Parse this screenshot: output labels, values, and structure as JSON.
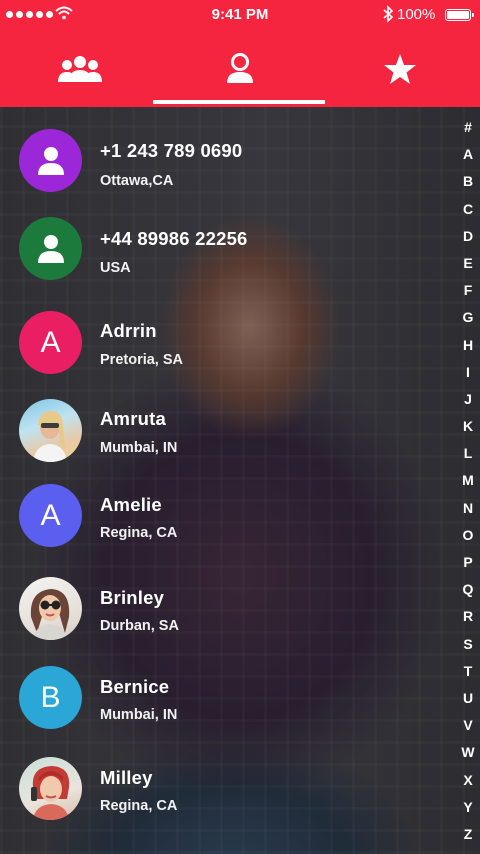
{
  "status_bar": {
    "time": "9:41 PM",
    "battery": "100%"
  },
  "tabs": [
    {
      "name": "groups",
      "icon": "group-icon",
      "selected": false
    },
    {
      "name": "contacts",
      "icon": "person-icon",
      "selected": true
    },
    {
      "name": "favorites",
      "icon": "star-icon",
      "selected": false
    }
  ],
  "colors": {
    "accent": "#f5253f",
    "avatar_purple": "#9c27d9",
    "avatar_green": "#1b7a3c",
    "avatar_pink": "#e91e63",
    "avatar_indigo": "#5b5ff0",
    "avatar_cyan": "#2aa7d6"
  },
  "contacts": [
    {
      "name": "+1 243 789 0690",
      "location": "Ottawa,CA",
      "avatar": "person-icon"
    },
    {
      "name": "+44  89986 22256",
      "location": "USA",
      "avatar": "person-icon"
    },
    {
      "name": "Adrrin",
      "location": "Pretoria, SA",
      "avatar": "A"
    },
    {
      "name": "Amruta",
      "location": "Mumbai, IN",
      "avatar": "photo"
    },
    {
      "name": "Amelie",
      "location": "Regina, CA",
      "avatar": "A"
    },
    {
      "name": "Brinley",
      "location": "Durban, SA",
      "avatar": "photo"
    },
    {
      "name": "Bernice",
      "location": "Mumbai, IN",
      "avatar": "B"
    },
    {
      "name": "Milley",
      "location": "Regina, CA",
      "avatar": "photo"
    }
  ],
  "alphabet_index": [
    "#",
    "A",
    "B",
    "C",
    "D",
    "E",
    "F",
    "G",
    "H",
    "I",
    "J",
    "K",
    "L",
    "M",
    "N",
    "O",
    "P",
    "Q",
    "R",
    "S",
    "T",
    "U",
    "V",
    "W",
    "X",
    "Y",
    "Z"
  ]
}
